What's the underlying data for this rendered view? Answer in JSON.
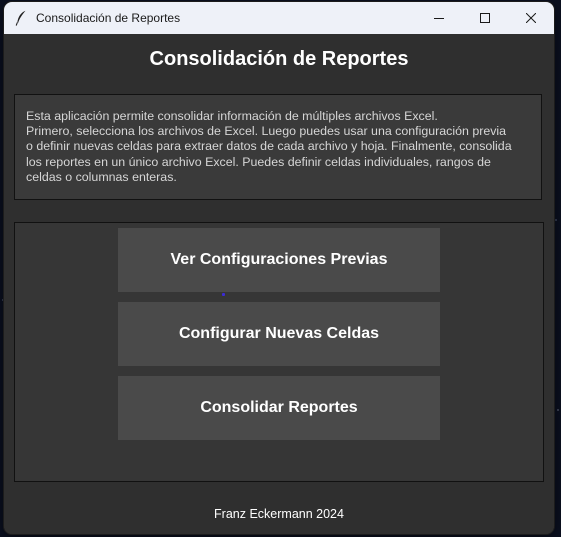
{
  "window": {
    "title": "Consolidación de Reportes",
    "controls": {
      "minimize": "minimize-icon",
      "maximize": "maximize-icon",
      "close": "close-icon"
    },
    "app_icon": "feather-icon"
  },
  "header": {
    "title": "Consolidación de Reportes"
  },
  "description": {
    "lines": [
      "Esta aplicación permite consolidar información de múltiples archivos Excel.",
      "Primero, selecciona los archivos de Excel. Luego puedes usar una configuración previa",
      "o definir nuevas celdas para extraer datos de cada archivo y hoja. Finalmente, consolida",
      "los reportes en un único archivo Excel. Puedes definir celdas individuales, rangos de",
      "celdas o columnas enteras."
    ]
  },
  "actions": {
    "view_configs": "Ver Configuraciones Previas",
    "configure_cells": "Configurar Nuevas Celdas",
    "consolidate": "Consolidar Reportes"
  },
  "footer": {
    "text": "Franz Eckermann 2024"
  },
  "colors": {
    "window_bg": "#2f2f2f",
    "titlebar_bg": "#eef1f8",
    "button_bg": "#4a4a4a",
    "text_primary": "#ffffff",
    "text_secondary": "#d6d6d6"
  }
}
